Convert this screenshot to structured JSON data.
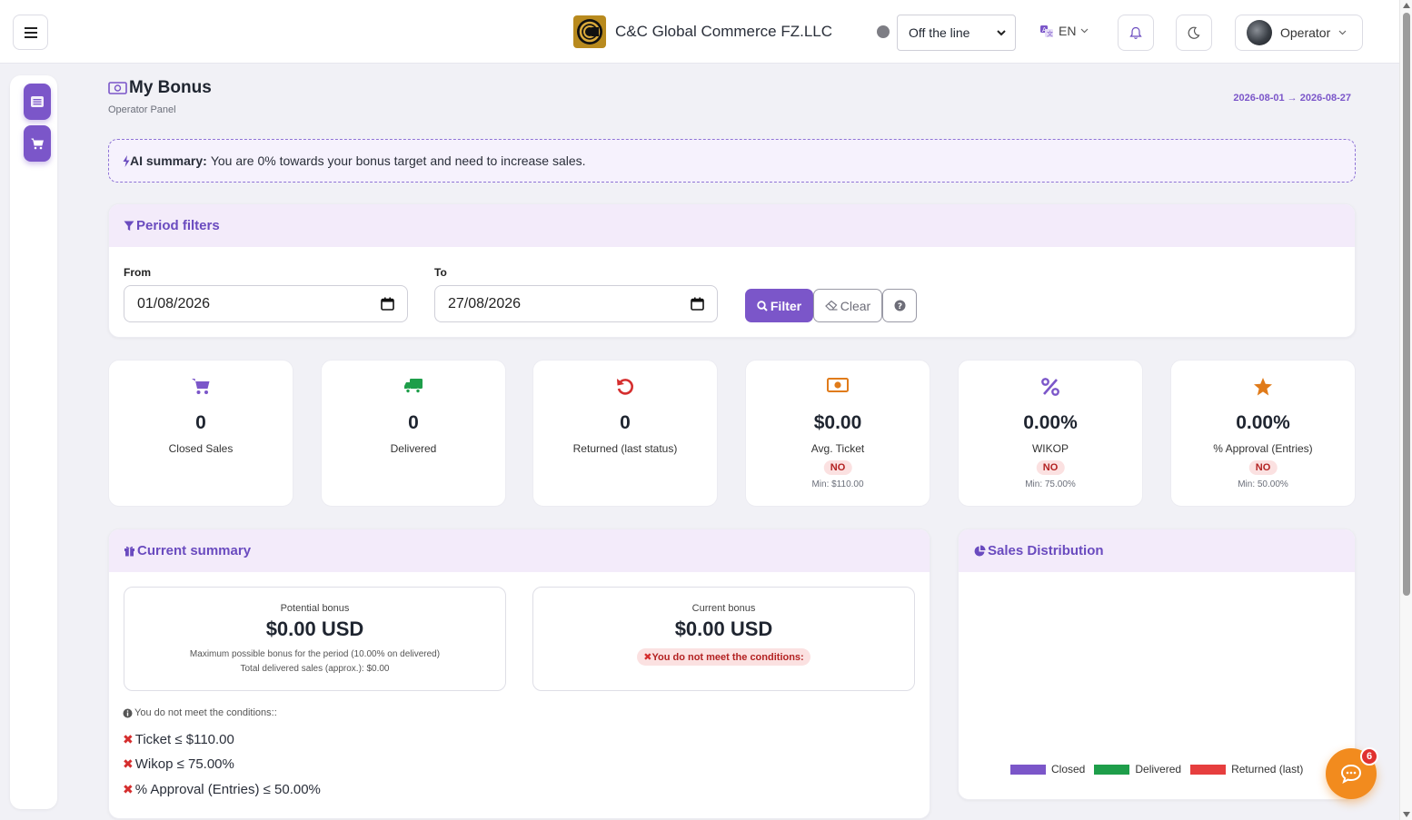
{
  "header": {
    "company": "C&C Global Commerce FZ.LLC",
    "status_value": "Off the line",
    "language": "EN",
    "user": "Operator"
  },
  "page": {
    "title": "My Bonus",
    "subtitle": "Operator Panel",
    "date_range": "2026-08-01 → 2026-08-27"
  },
  "ai_summary": {
    "label": "AI summary:",
    "text": "You are 0% towards your bonus target and need to increase sales."
  },
  "filters": {
    "title": "Period filters",
    "from_label": "From",
    "from_value": "01/08/2026",
    "to_label": "To",
    "to_value": "27/08/2026",
    "filter_button": "Filter",
    "clear_button": "Clear"
  },
  "stats": [
    {
      "value": "0",
      "label": "Closed Sales",
      "icon": "cart-icon",
      "color": "#7b56c9"
    },
    {
      "value": "0",
      "label": "Delivered",
      "icon": "truck-icon",
      "color": "#1e9e4a"
    },
    {
      "value": "0",
      "label": "Returned (last status)",
      "icon": "undo-icon",
      "color": "#d52e2e"
    },
    {
      "value": "$0.00",
      "label": "Avg. Ticket",
      "badge": "NO",
      "min": "Min: $110.00",
      "icon": "money-icon",
      "color": "#e07b1a"
    },
    {
      "value": "0.00%",
      "label": "WIKOP",
      "badge": "NO",
      "min": "Min: 75.00%",
      "icon": "percent-icon",
      "color": "#7b56c9"
    },
    {
      "value": "0.00%",
      "label": "% Approval (Entries)",
      "badge": "NO",
      "min": "Min: 50.00%",
      "icon": "star-icon",
      "color": "#e07b1a"
    }
  ],
  "summary": {
    "title": "Current summary",
    "potential_title": "Potential bonus",
    "potential_amount": "$0.00 USD",
    "potential_note1": "Maximum possible bonus for the period (10.00% on delivered)",
    "potential_note2": "Total delivered sales (approx.): $0.00",
    "current_title": "Current bonus",
    "current_amount": "$0.00 USD",
    "current_warning": "You do not meet the conditions:",
    "conditions_head": "You do not meet the conditions::",
    "conditions": [
      "Ticket ≤ $110.00",
      "Wikop ≤ 75.00%",
      "% Approval (Entries) ≤ 50.00%"
    ]
  },
  "chart_data": {
    "type": "pie",
    "title": "Sales Distribution",
    "labels": [
      "Closed",
      "Delivered",
      "Returned (last)"
    ],
    "values": [
      0,
      0,
      0
    ],
    "colors": [
      "#7b56c9",
      "#1e9e4a",
      "#e63e3e"
    ],
    "legend": "bottom"
  },
  "chat": {
    "badge_count": "6"
  },
  "colors": {
    "accent": "#7b56c9",
    "chat": "#f28b1e",
    "danger": "#d52e2e"
  }
}
